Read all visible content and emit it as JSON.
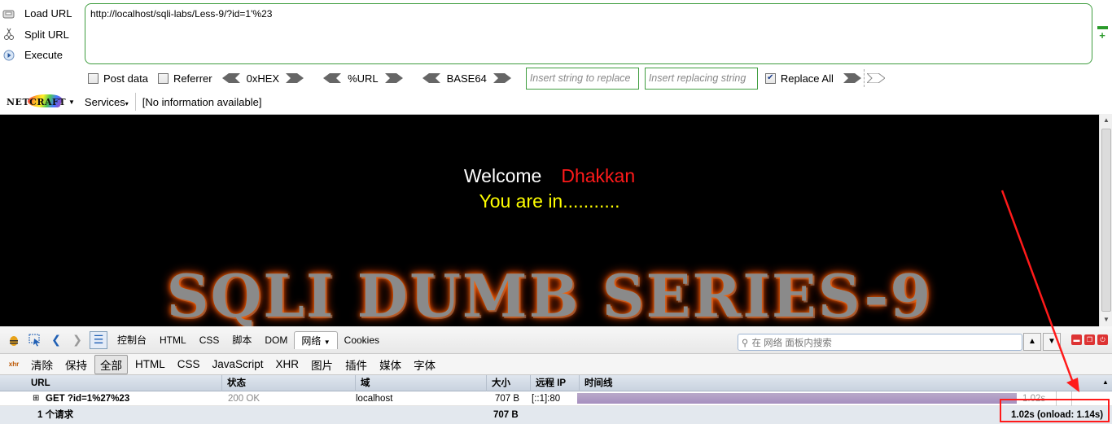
{
  "hackbar": {
    "actions": [
      {
        "label": "Load URL",
        "icon": "load-url-icon"
      },
      {
        "label": "Split URL",
        "icon": "split-url-icon"
      },
      {
        "label": "Execute",
        "icon": "execute-icon"
      }
    ],
    "url": "http://localhost/sqli-labs/Less-9/?id=1'%23",
    "post_data_label": "Post data",
    "referrer_label": "Referrer",
    "hex_label": "0xHEX",
    "url_enc_label": "%URL",
    "base64_label": "BASE64",
    "replace_placeholder": "Insert string to replace",
    "replacing_placeholder": "Insert replacing string",
    "replace_all_label": "Replace All",
    "replace_all_checked": true,
    "services_label": "Services",
    "info_text": "[No information available]",
    "netcraft_text": "NETCRAFT"
  },
  "page": {
    "welcome": "Welcome",
    "name": "Dhakkan",
    "status": "You are in...........",
    "banner": "SQLI DUMB SERIES-9"
  },
  "firebug": {
    "tabs": [
      "控制台",
      "HTML",
      "CSS",
      "脚本",
      "DOM",
      "网络",
      "Cookies"
    ],
    "active_tab": "网络",
    "search_placeholder": "在 网络 面板内搜索",
    "filters": [
      "清除",
      "保持",
      "全部",
      "HTML",
      "CSS",
      "JavaScript",
      "XHR",
      "图片",
      "插件",
      "媒体",
      "字体"
    ],
    "active_filter": "全部",
    "columns": {
      "url": "URL",
      "status": "状态",
      "domain": "域",
      "size": "大小",
      "ip": "远程 IP",
      "timeline": "时间线"
    },
    "request": {
      "url": "GET ?id=1%27%23",
      "status": "200 OK",
      "domain": "localhost",
      "size": "707 B",
      "ip": "[::1]:80",
      "time": "1.02s"
    },
    "footer": {
      "count": "1 个请求",
      "size": "707 B",
      "timing": "1.02s (onload: 1.14s)"
    }
  },
  "colors": {
    "accent_green": "#3f9d3f",
    "name_red": "#ff1a1a",
    "status_yellow": "#ffff00",
    "annotation_red": "#ff1a1a"
  }
}
